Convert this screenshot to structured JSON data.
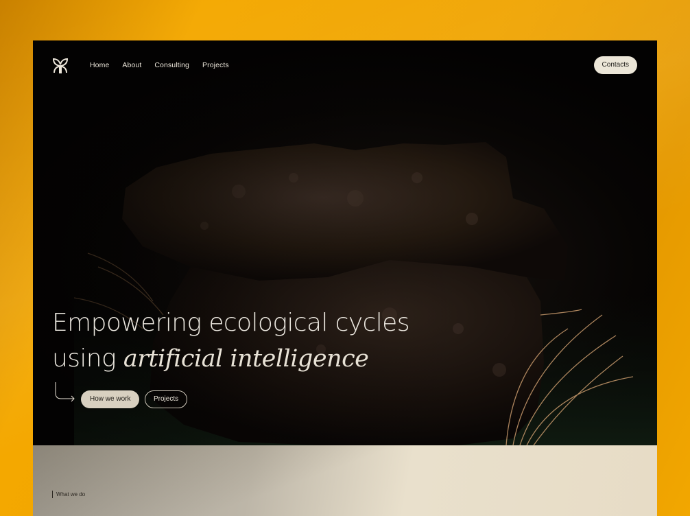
{
  "nav": {
    "links": [
      "Home",
      "About",
      "Consulting",
      "Projects"
    ],
    "contacts_label": "Contacts"
  },
  "hero": {
    "headline_line1": "Empowering ecological cycles",
    "headline_line2_plain": "using ",
    "headline_line2_emph": "artificial intelligence",
    "primary_cta": "How we work",
    "secondary_cta": "Projects"
  },
  "section": {
    "label": "What we do"
  },
  "icons": {
    "logo": "butterfly-logo-icon",
    "cta_arrow": "curved-arrow-icon"
  },
  "colors": {
    "backdrop": "#f4a800",
    "hero_bg": "#050403",
    "text_light": "#ece6da",
    "button_light": "#ece6d8",
    "section_bg": "#e9e0cc"
  }
}
